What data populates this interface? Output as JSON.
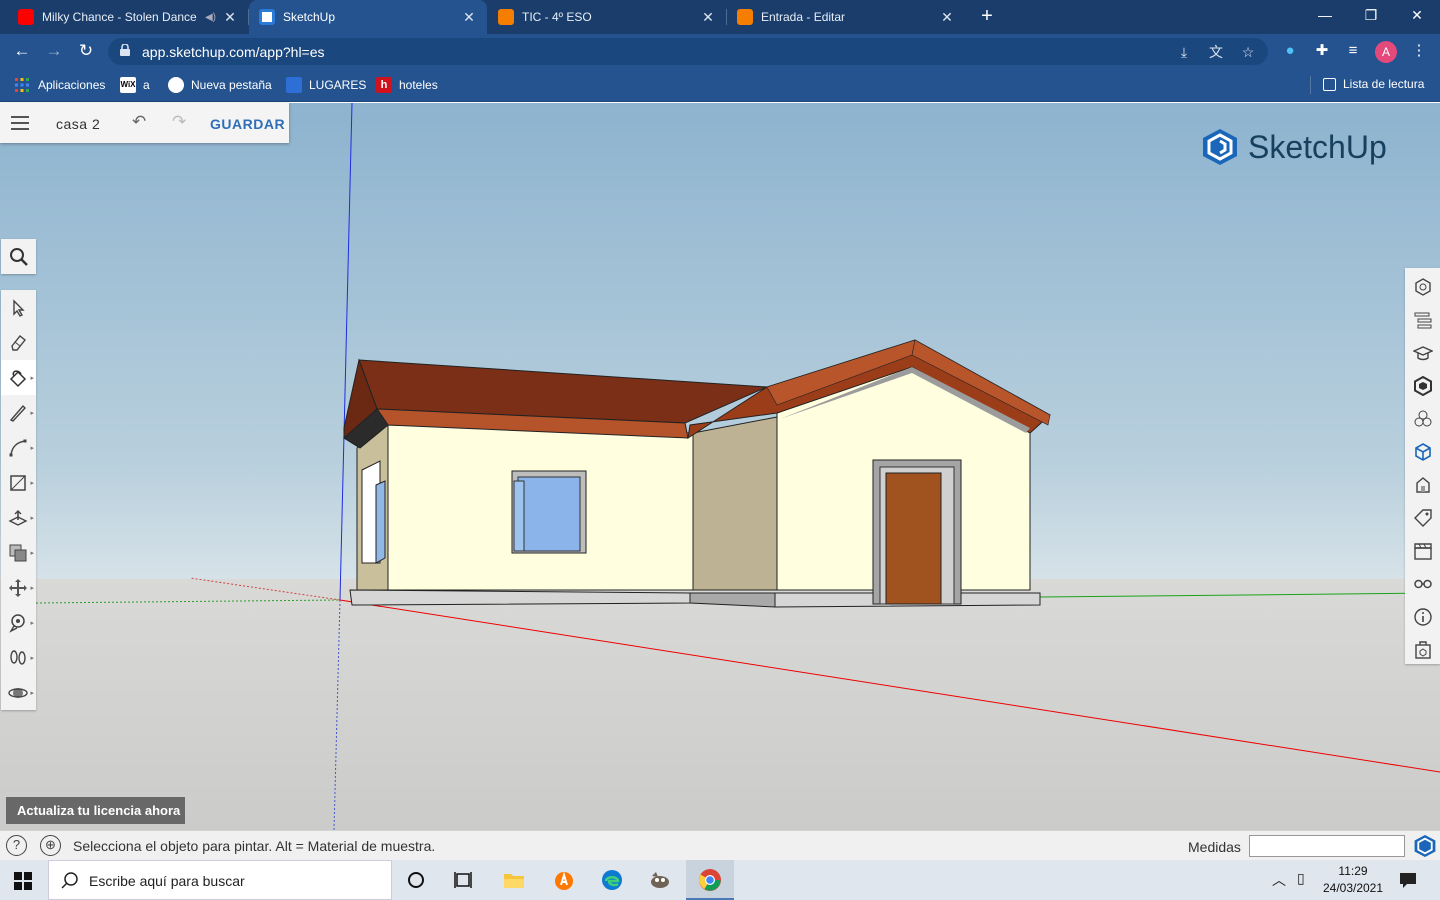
{
  "browser": {
    "tabs": [
      {
        "title": "Milky Chance - Stolen Dance",
        "favicon": "youtube-icon",
        "color": "#ff0000",
        "active": false
      },
      {
        "title": "SketchUp",
        "favicon": "sketchup-icon",
        "color": "#2b7bd8",
        "active": true
      },
      {
        "title": "TIC - 4º ESO",
        "favicon": "blogger-icon",
        "color": "#f57d00",
        "active": false
      },
      {
        "title": "Entrada - Editar",
        "favicon": "blogger-icon",
        "color": "#f57d00",
        "active": false
      }
    ],
    "url": "app.sketchup.com/app?hl=es",
    "profile_initial": "A",
    "bookmarks": [
      {
        "label": "Aplicaciones",
        "icon": "apps-grid-icon"
      },
      {
        "label": "a",
        "icon": "wix-icon"
      },
      {
        "label": "Nueva pestaña",
        "icon": "globe-icon"
      },
      {
        "label": "LUGARES",
        "icon": "lugares-icon"
      },
      {
        "label": "hoteles",
        "icon": "hoteles-icon"
      }
    ],
    "reading_list": "Lista de lectura"
  },
  "app": {
    "file_name": "casa 2",
    "save_label": "GUARDAR",
    "logo_text": "SketchUp",
    "license_label": "Actualiza tu licencia ahora",
    "left_tools": [
      "select-tool-icon",
      "eraser-tool-icon",
      "paint-bucket-tool-icon",
      "line-tool-icon",
      "arc-tool-icon",
      "rectangle-tool-icon",
      "push-pull-tool-icon",
      "offset-tool-icon",
      "move-tool-icon",
      "tape-measure-tool-icon",
      "walk-tool-icon",
      "orbit-tool-icon"
    ],
    "active_tool": "paint-bucket-tool-icon",
    "right_panels": [
      "entity-info-icon",
      "outliner-icon",
      "instructor-icon",
      "components-icon",
      "materials-icon",
      "styles-icon",
      "tags-icon",
      "scenes-icon",
      "display-icon",
      "info-icon",
      "3d-warehouse-icon"
    ]
  },
  "status": {
    "message": "Selecciona el objeto para pintar. Alt = Material de muestra.",
    "measurements_label": "Medidas",
    "measurements_value": ""
  },
  "taskbar": {
    "search_placeholder": "Escribe aquí para buscar",
    "time": "11:29",
    "date": "24/03/2021"
  },
  "colors": {
    "chrome_dark": "#1a3d6b",
    "chrome_bar": "#24538f",
    "save_blue": "#2f6fb8",
    "wall_cream": "#ffffe0",
    "roof_brown": "#8b3a1e"
  }
}
